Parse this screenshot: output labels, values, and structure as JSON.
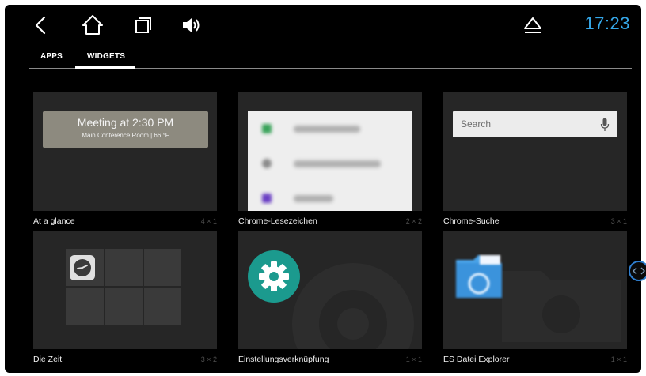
{
  "status_bar": {
    "back_icon": "back-chevron-icon",
    "home_icon": "home-outline-icon",
    "recents_icon": "recents-square-icon",
    "volume_icon": "volume-speaker-icon",
    "eject_icon": "eject-icon",
    "clock": "17:23",
    "clock_color": "#35a7e8"
  },
  "tabs": [
    {
      "label": "APPS",
      "selected": false
    },
    {
      "label": "WIDGETS",
      "selected": true
    }
  ],
  "widgets": [
    {
      "name": "At a glance",
      "size": "4 × 1",
      "preview": {
        "title": "Meeting at 2:30 PM",
        "subtitle": "Main Conference Room | 66 °F"
      }
    },
    {
      "name": "Chrome-Lesezeichen",
      "size": "2 × 2"
    },
    {
      "name": "Chrome-Suche",
      "size": "3 × 1",
      "preview": {
        "placeholder": "Search"
      }
    },
    {
      "name": "Die Zeit",
      "size": "3 × 2"
    },
    {
      "name": "Einstellungsverknüpfung",
      "size": "1 × 1"
    },
    {
      "name": "ES Datei Explorer",
      "size": "1 × 1"
    }
  ],
  "colors": {
    "background": "#000000",
    "card": "#262626",
    "accent": "#35a7e8",
    "settings_icon": "#1b9a8e"
  }
}
